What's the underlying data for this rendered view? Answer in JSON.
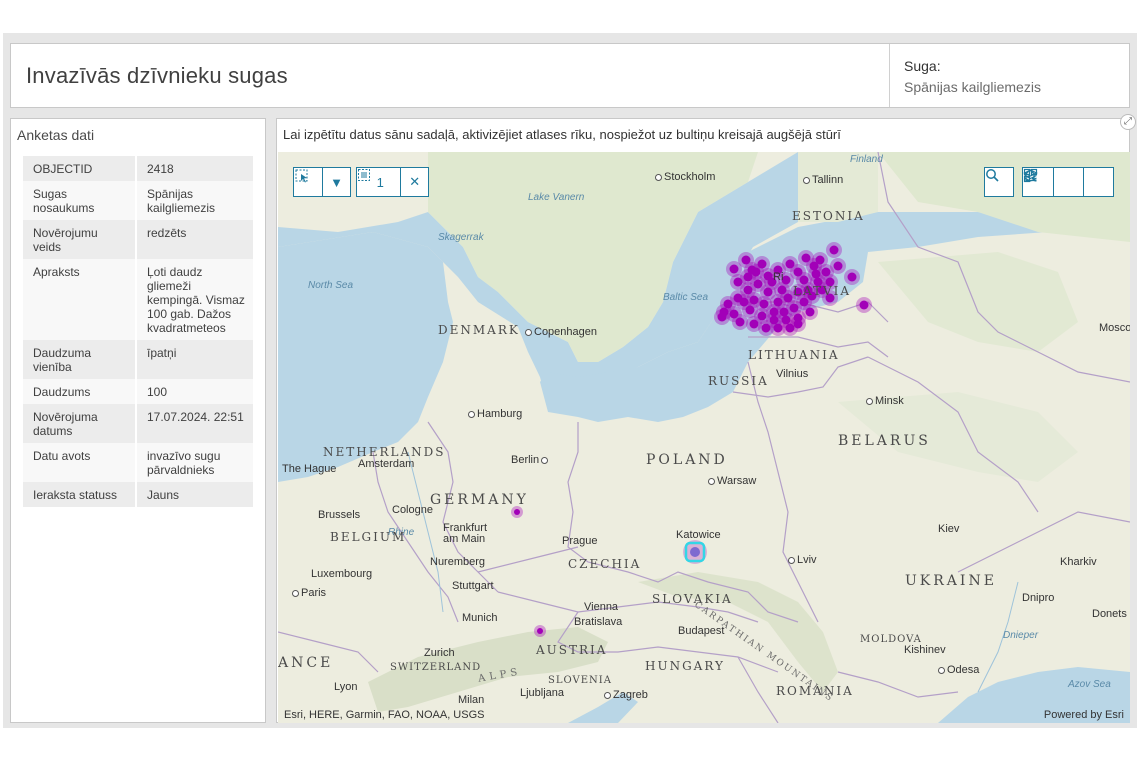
{
  "header": {
    "title": "Invazīvās dzīvnieku sugas",
    "suga_label": "Suga:",
    "suga_value": "Spānijas kailgliemezis"
  },
  "form": {
    "title": "Anketas dati",
    "rows": [
      {
        "key": "OBJECTID",
        "value": "2418"
      },
      {
        "key": "Sugas nosaukums",
        "value": "Spānijas kailgliemezis"
      },
      {
        "key": "Novērojumu veids",
        "value": "redzēts"
      },
      {
        "key": "Apraksts",
        "value": "Ļoti daudz gliemeži kempingā. Vismaz 100 gab. Dažos kvadratmeteos"
      },
      {
        "key": "Daudzuma vienība",
        "value": "īpatņi"
      },
      {
        "key": "Daudzums",
        "value": "100"
      },
      {
        "key": "Novērojuma datums",
        "value": "17.07.2024. 22:51"
      },
      {
        "key": "Datu avots",
        "value": "invazīvo sugu pārvaldnieks"
      },
      {
        "key": "Ieraksta statuss",
        "value": "Jauns"
      }
    ]
  },
  "map": {
    "instruction": "Lai izpētītu datus sānu sadaļā, aktivizējiet atlases rīku, nospiežot uz bultiņu kreisajā augšējā stūrī",
    "selection_count": "1",
    "attribution": "Esri, HERE, Garmin, FAO, NOAA, USGS",
    "powered_by": "Powered by Esri",
    "colors": {
      "point": "#a200b8",
      "selected": "#33d6e6",
      "water": "#b9d6e6",
      "land": "#ededdf",
      "accent": "#1f7a9e"
    },
    "icons": [
      "select-icon",
      "dropdown-arrow-icon",
      "selection-icon",
      "close-icon",
      "search-icon",
      "home-icon",
      "layers-icon",
      "qr-icon",
      "expand-icon"
    ],
    "labels": {
      "countries": [
        "ESTONIA",
        "LATVIA",
        "LITHUANIA",
        "RUSSIA",
        "DENMARK",
        "BELARUS",
        "POLAND",
        "GERMANY",
        "NETHERLANDS",
        "BELGIUM",
        "CZECHIA",
        "SLOVAKIA",
        "AUSTRIA",
        "UKRAINE",
        "HUNGARY",
        "SLOVENIA",
        "SWITZERLAND",
        "ROMANIA",
        "MOLDOVA",
        "ANCE"
      ],
      "cities": [
        "Stockholm",
        "Tallinn",
        "Copenhagen",
        "Vilnius",
        "Minsk",
        "Hamburg",
        "Berlin",
        "Amsterdam",
        "The Hague",
        "Warsaw",
        "Brussels",
        "Cologne",
        "Frankfurt am Main",
        "Prague",
        "Katowice",
        "Nuremberg",
        "Luxembourg",
        "Stuttgart",
        "Paris",
        "Vienna",
        "Bratislava",
        "Munich",
        "Budapest",
        "Zurich",
        "Lyon",
        "Milan",
        "Ljubljana",
        "Zagreb",
        "Lviv",
        "Kiev",
        "Kharkiv",
        "Dnipro",
        "Donets",
        "Kishinev",
        "Odesa",
        "Mosco",
        "Ri"
      ],
      "waters": [
        "North Sea",
        "Skagerrak",
        "Lake Vanern",
        "Baltic Sea",
        "Finland",
        "Azov Sea",
        "Dnieper",
        "Rhine"
      ],
      "mountains": [
        "CARPATHIAN MOUNTAINS",
        "ALPS"
      ]
    }
  }
}
